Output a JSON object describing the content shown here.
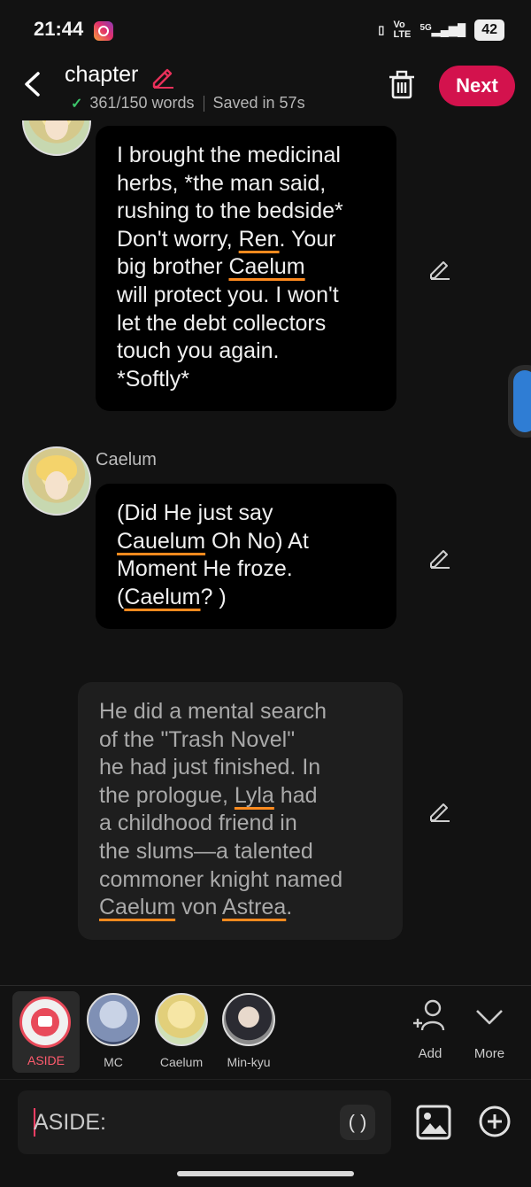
{
  "status_bar": {
    "time": "21:44",
    "network": "5G",
    "volte": "Vo LTE",
    "battery": "42"
  },
  "header": {
    "title": "chapter",
    "word_count": "361/150 words",
    "saved": "Saved in 57s",
    "next_label": "Next"
  },
  "messages": [
    {
      "speaker": "",
      "lines": [
        [
          {
            "t": "I brought the medicinal"
          }
        ],
        [
          {
            "t": "herbs, *the man said,"
          }
        ],
        [
          {
            "t": "rushing to the bedside*"
          }
        ],
        [
          {
            "t": "Don't worry, "
          },
          {
            "t": "Ren",
            "u": true
          },
          {
            "t": ". Your"
          }
        ],
        [
          {
            "t": "big brother "
          },
          {
            "t": "Caelum",
            "u": true
          }
        ],
        [
          {
            "t": "will protect you. I won't"
          }
        ],
        [
          {
            "t": "let the debt collectors"
          }
        ],
        [
          {
            "t": "touch you again."
          }
        ],
        [
          {
            "t": "*Softly*"
          }
        ]
      ]
    },
    {
      "speaker": "Caelum",
      "lines": [
        [
          {
            "t": "(Did He just say"
          }
        ],
        [
          {
            "t": "Cauelum",
            "u": true
          },
          {
            "t": " Oh No) At"
          }
        ],
        [
          {
            "t": "Moment He froze."
          }
        ],
        [
          {
            "t": "("
          },
          {
            "t": "Caelum",
            "u": true
          },
          {
            "t": "? )"
          }
        ]
      ]
    },
    {
      "speaker": "",
      "aside": true,
      "lines": [
        [
          {
            "t": "He did a mental search"
          }
        ],
        [
          {
            "t": "of the \"Trash Novel\""
          }
        ],
        [
          {
            "t": "he had just finished. In"
          }
        ],
        [
          {
            "t": "the prologue, "
          },
          {
            "t": "Lyla",
            "u": true
          },
          {
            "t": " had"
          }
        ],
        [
          {
            "t": "a childhood friend in"
          }
        ],
        [
          {
            "t": "the slums—a talented"
          }
        ],
        [
          {
            "t": "commoner knight named"
          }
        ],
        [
          {
            "t": "Caelum",
            "u": true
          },
          {
            "t": " von "
          },
          {
            "t": "Astrea",
            "u": true
          },
          {
            "t": "."
          }
        ]
      ]
    }
  ],
  "characters": {
    "aside": "ASIDE",
    "mc": "MC",
    "caelum": "Caelum",
    "minkyu": "Min-kyu",
    "add": "Add",
    "more": "More"
  },
  "input": {
    "value": "ASIDE:",
    "paren": "( )"
  },
  "colors": {
    "accent": "#d3124d",
    "underline": "#ff8a1e",
    "aside_red": "#e84a5a"
  }
}
